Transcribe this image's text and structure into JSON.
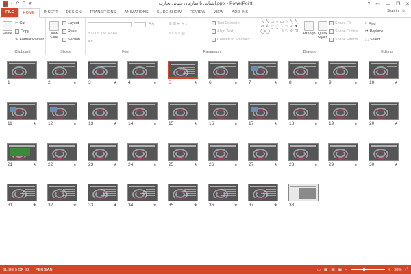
{
  "window": {
    "title": "آشنایی با سازمان جهانی تجارت.pptx - PowerPoint",
    "app_icon_letter": "P",
    "controls": [
      "?",
      "▭",
      "—",
      "❐",
      "✕"
    ]
  },
  "ribbon_tabs": [
    "FILE",
    "HOME",
    "INSERT",
    "DESIGN",
    "TRANSITIONS",
    "ANIMATIONS",
    "SLIDE SHOW",
    "REVIEW",
    "VIEW",
    "ADD-INS"
  ],
  "active_tab": "HOME",
  "account": {
    "sign_in": "Sign in"
  },
  "clipboard": {
    "paste": "Paste",
    "cut": "Cut",
    "copy": "Copy",
    "format_painter": "Format Painter",
    "label": "Clipboard"
  },
  "slides_group": {
    "new_slide": "New Slide",
    "layout": "Layout",
    "reset": "Reset",
    "section": "Section",
    "label": "Slides"
  },
  "font_group": {
    "label": "Font"
  },
  "paragraph_group": {
    "text_direction": "Text Direction",
    "align_text": "Align Text",
    "convert_smartart": "Convert to SmartArt",
    "label": "Paragraph"
  },
  "drawing_group": {
    "arrange": "Arrange",
    "quick_styles": "Quick Styles",
    "shape_fill": "Shape Fill",
    "shape_outline": "Shape Outline",
    "shape_effects": "Shape Effects",
    "label": "Drawing"
  },
  "editing_group": {
    "find": "Find",
    "replace": "Replace",
    "select": "Select",
    "label": "Editing"
  },
  "slides": [
    {
      "num": "1",
      "star": false,
      "selected": false
    },
    {
      "num": "2",
      "star": true,
      "selected": false
    },
    {
      "num": "3",
      "star": true,
      "selected": false
    },
    {
      "num": "4",
      "star": true,
      "selected": false
    },
    {
      "num": "5",
      "star": true,
      "selected": true
    },
    {
      "num": "6",
      "star": true,
      "selected": false
    },
    {
      "num": "7",
      "star": true,
      "selected": false
    },
    {
      "num": "8",
      "star": true,
      "selected": false
    },
    {
      "num": "9",
      "star": true,
      "selected": false
    },
    {
      "num": "10",
      "star": true,
      "selected": false
    },
    {
      "num": "11",
      "star": true,
      "selected": false
    },
    {
      "num": "12",
      "star": true,
      "selected": false
    },
    {
      "num": "13",
      "star": true,
      "selected": false
    },
    {
      "num": "14",
      "star": true,
      "selected": false
    },
    {
      "num": "15",
      "star": true,
      "selected": false
    },
    {
      "num": "16",
      "star": true,
      "selected": false
    },
    {
      "num": "17",
      "star": true,
      "selected": false
    },
    {
      "num": "18",
      "star": true,
      "selected": false
    },
    {
      "num": "19",
      "star": true,
      "selected": false
    },
    {
      "num": "20",
      "star": true,
      "selected": false
    },
    {
      "num": "21",
      "star": true,
      "selected": false
    },
    {
      "num": "22",
      "star": true,
      "selected": false
    },
    {
      "num": "23",
      "star": true,
      "selected": false
    },
    {
      "num": "24",
      "star": true,
      "selected": false
    },
    {
      "num": "25",
      "star": true,
      "selected": false
    },
    {
      "num": "26",
      "star": true,
      "selected": false
    },
    {
      "num": "27",
      "star": true,
      "selected": false
    },
    {
      "num": "28",
      "star": true,
      "selected": false
    },
    {
      "num": "29",
      "star": true,
      "selected": false
    },
    {
      "num": "30",
      "star": true,
      "selected": false
    },
    {
      "num": "31",
      "star": true,
      "selected": false
    },
    {
      "num": "32",
      "star": true,
      "selected": false
    },
    {
      "num": "33",
      "star": true,
      "selected": false
    },
    {
      "num": "34",
      "star": true,
      "selected": false
    },
    {
      "num": "35",
      "star": true,
      "selected": false
    },
    {
      "num": "36",
      "star": true,
      "selected": false
    },
    {
      "num": "37",
      "star": true,
      "selected": false
    },
    {
      "num": "38",
      "star": false,
      "selected": false
    }
  ],
  "status": {
    "slide_info": "SLIDE 5 OF 38",
    "language": "PERSIAN",
    "zoom": "38%",
    "zoom_fraction": 0.38
  },
  "colors": {
    "accent": "#d24726",
    "selected_border": "#d24726"
  },
  "icons": [
    "undo-icon",
    "redo-icon",
    "save-icon",
    "scissors-icon",
    "copy-icon",
    "brush-icon",
    "find-icon"
  ]
}
